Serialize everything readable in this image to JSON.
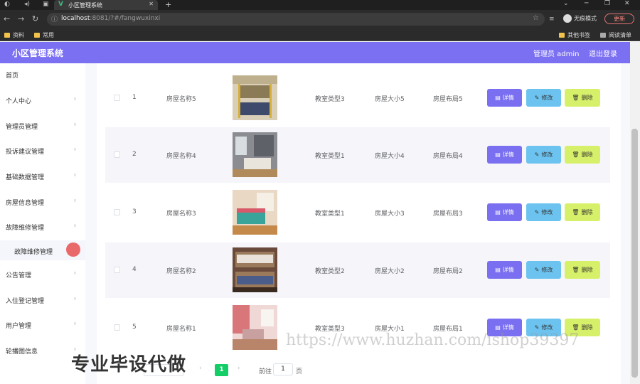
{
  "browser": {
    "tab_title": "小区管理系统",
    "url_host": "localhost",
    "url_rest": ":8081/?#/fangwuxinxi",
    "incognito_label": "无痕模式",
    "update_label": "更新",
    "bookmarks": [
      "资料",
      "常用"
    ],
    "bookmarks_right": [
      "其他书签",
      "阅读清单"
    ]
  },
  "app": {
    "title": "小区管理系统",
    "user_label": "管理员 admin",
    "logout_label": "退出登录"
  },
  "sidebar": {
    "items": [
      "首页",
      "个人中心",
      "管理员管理",
      "投诉建议管理",
      "基础数据管理",
      "房屋信息管理",
      "故障维修管理",
      "公告管理",
      "入住登记管理",
      "用户管理",
      "轮播图信息"
    ],
    "subitem": "故障维修管理"
  },
  "table": {
    "rows": [
      {
        "index": "1",
        "name": "房屋名称5",
        "type": "教室类型3",
        "size": "房屋大小5",
        "layout": "房屋布局5",
        "photo_color": "#8a7a55"
      },
      {
        "index": "2",
        "name": "房屋名称4",
        "type": "教室类型1",
        "size": "房屋大小4",
        "layout": "房屋布局4",
        "photo_color": "#7d7f86"
      },
      {
        "index": "3",
        "name": "房屋名称3",
        "type": "教室类型1",
        "size": "房屋大小3",
        "layout": "房屋布局3",
        "photo_color": "#c8a888"
      },
      {
        "index": "4",
        "name": "房屋名称2",
        "type": "教室类型2",
        "size": "房屋大小2",
        "layout": "房屋布局2",
        "photo_color": "#6a4a3a"
      },
      {
        "index": "5",
        "name": "房屋名称1",
        "type": "教室类型3",
        "size": "房屋大小1",
        "layout": "房屋布局1",
        "photo_color": "#c97a7a"
      }
    ],
    "buttons": {
      "detail": "详情",
      "edit": "修改",
      "delete": "删除"
    }
  },
  "pagination": {
    "current_page": "1",
    "goto_prefix": "前往",
    "goto_value": "1",
    "goto_suffix": "页"
  },
  "overlay": {
    "caption": "专业毕设代做",
    "watermark": "https://www.huzhan.com/ishop39397"
  }
}
